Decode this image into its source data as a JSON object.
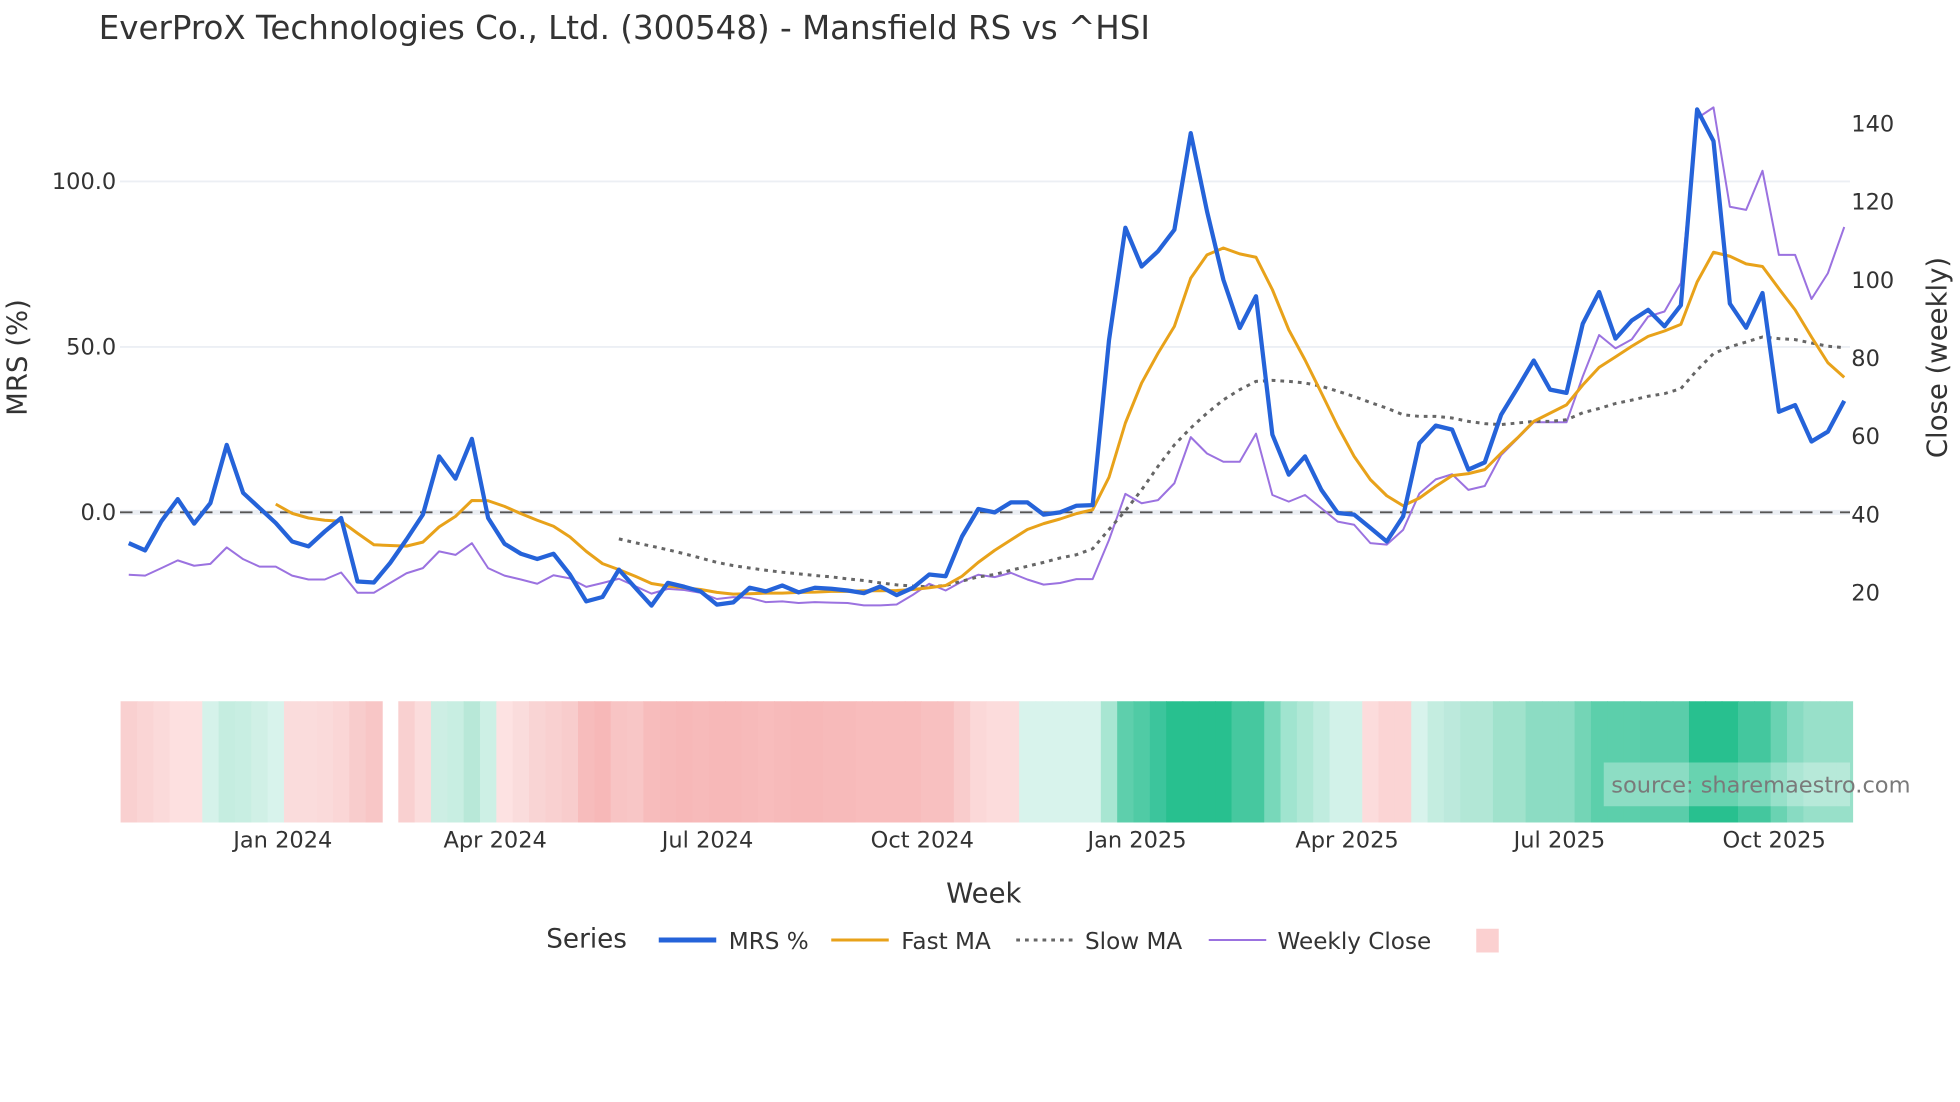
{
  "chart_data": {
    "type": "line",
    "title": "EverProX Technologies Co., Ltd. (300548) - Mansfield RS vs ^HSI",
    "xlabel": "Week",
    "ylabel": "MRS (%)",
    "y2label": "Close (weekly)",
    "x_start": "2023-10-27",
    "x_step_days": 7,
    "ylim": [
      -45,
      125
    ],
    "y2lim": [
      2.6,
      146.4
    ],
    "yticks": [
      {
        "value": 0,
        "label": "0.0"
      },
      {
        "value": 50,
        "label": "50.0"
      },
      {
        "value": 100,
        "label": "100.0"
      }
    ],
    "y2ticks": [
      {
        "value": 20,
        "label": "20"
      },
      {
        "value": 40,
        "label": "40"
      },
      {
        "value": 60,
        "label": "60"
      },
      {
        "value": 80,
        "label": "80"
      },
      {
        "value": 100,
        "label": "100"
      },
      {
        "value": 120,
        "label": "120"
      },
      {
        "value": 140,
        "label": "140"
      }
    ],
    "xticks": [
      {
        "date": "2024-01-01",
        "label": "Jan 2024"
      },
      {
        "date": "2024-04-01",
        "label": "Apr 2024"
      },
      {
        "date": "2024-07-01",
        "label": "Jul 2024"
      },
      {
        "date": "2024-10-01",
        "label": "Oct 2024"
      },
      {
        "date": "2025-01-01",
        "label": "Jan 2025"
      },
      {
        "date": "2025-04-01",
        "label": "Apr 2025"
      },
      {
        "date": "2025-07-01",
        "label": "Jul 2025"
      },
      {
        "date": "2025-10-01",
        "label": "Oct 2025"
      }
    ],
    "reference_line": 0,
    "grid": true,
    "legend": {
      "title": "Series",
      "placement": "bottom"
    },
    "series": [
      {
        "name": "MRS %",
        "axis": "y",
        "color": "#2563d9",
        "style": "solid",
        "values": [
          -9.3,
          -11.5,
          -2.7,
          4.0,
          -3.4,
          2.8,
          20.4,
          5.9,
          1.3,
          -3.2,
          -8.8,
          -10.3,
          -5.8,
          -1.7,
          -20.9,
          -21.2,
          -15.3,
          -8.2,
          -0.7,
          16.9,
          10.2,
          22.2,
          -1.7,
          -9.5,
          -12.5,
          -14.1,
          -12.5,
          -18.8,
          -26.9,
          -25.6,
          -17.3,
          -22.8,
          -28.2,
          -21.3,
          -22.5,
          -23.9,
          -27.9,
          -27.2,
          -22.8,
          -23.9,
          -22.1,
          -24.2,
          -22.8,
          -23.1,
          -23.6,
          -24.4,
          -22.4,
          -25.0,
          -22.8,
          -18.8,
          -19.3,
          -7.3,
          1.0,
          0.0,
          3.0,
          3.0,
          -0.7,
          0.0,
          2.0,
          2.2,
          52.0,
          86.0,
          74.3,
          78.9,
          85.4,
          114.6,
          91.0,
          70.3,
          55.7,
          65.3,
          23.5,
          11.4,
          16.9,
          6.8,
          -0.2,
          -0.7,
          -4.7,
          -8.8,
          -1.2,
          20.9,
          26.2,
          25.0,
          12.9,
          15.1,
          29.5,
          37.6,
          45.9,
          37.1,
          36.1,
          57.0,
          66.6,
          52.5,
          58.0,
          61.2,
          56.2,
          62.6,
          121.8,
          112.2,
          63.1,
          55.8,
          66.3,
          30.4,
          32.4,
          21.4,
          24.4,
          33.7
        ]
      },
      {
        "name": "Fast MA",
        "axis": "y",
        "color": "#e8a21a",
        "style": "solid",
        "values": [
          null,
          null,
          null,
          null,
          null,
          null,
          null,
          null,
          null,
          2.5,
          -0.3,
          -1.7,
          -2.4,
          -2.7,
          -6.3,
          -9.8,
          -10.0,
          -10.2,
          -9.0,
          -4.4,
          -1.2,
          3.6,
          3.5,
          1.8,
          -0.4,
          -2.4,
          -4.2,
          -7.4,
          -11.8,
          -15.5,
          -17.3,
          -19.3,
          -21.5,
          -22.3,
          -22.8,
          -23.3,
          -24.2,
          -24.7,
          -24.6,
          -24.4,
          -24.4,
          -24.2,
          -24.1,
          -23.9,
          -23.9,
          -23.7,
          -23.7,
          -23.6,
          -23.3,
          -22.8,
          -22.1,
          -19.3,
          -15.1,
          -11.5,
          -8.3,
          -5.2,
          -3.4,
          -2.0,
          -0.4,
          0.8,
          10.6,
          27.0,
          39.1,
          48.1,
          56.2,
          70.8,
          77.8,
          79.9,
          78.1,
          77.1,
          67.3,
          55.2,
          46.1,
          36.1,
          26.0,
          16.9,
          9.9,
          5.0,
          2.0,
          4.3,
          7.9,
          11.1,
          11.7,
          12.9,
          17.9,
          22.5,
          27.5,
          30.0,
          32.5,
          38.5,
          43.8,
          47.0,
          50.2,
          53.2,
          54.8,
          56.8,
          69.6,
          78.6,
          77.4,
          75.1,
          74.3,
          67.6,
          61.2,
          53.0,
          45.2,
          40.8
        ]
      },
      {
        "name": "Slow MA",
        "axis": "y",
        "color": "#666666",
        "style": "dot",
        "values": [
          null,
          null,
          null,
          null,
          null,
          null,
          null,
          null,
          null,
          null,
          null,
          null,
          null,
          null,
          null,
          null,
          null,
          null,
          null,
          null,
          null,
          null,
          null,
          null,
          null,
          null,
          null,
          null,
          null,
          null,
          -8.0,
          -9.2,
          -10.2,
          -11.3,
          -12.5,
          -13.8,
          -15.1,
          -16.1,
          -16.8,
          -17.5,
          -18.1,
          -18.6,
          -19.1,
          -19.5,
          -20.1,
          -20.6,
          -21.3,
          -21.9,
          -22.3,
          -22.5,
          -22.1,
          -20.8,
          -19.5,
          -18.8,
          -17.5,
          -16.3,
          -15.1,
          -13.8,
          -12.8,
          -11.0,
          -5.2,
          0.5,
          6.8,
          13.9,
          20.4,
          25.5,
          30.0,
          34.0,
          37.1,
          39.6,
          39.9,
          39.6,
          39.1,
          38.1,
          36.6,
          35.0,
          33.2,
          31.5,
          29.5,
          29.0,
          29.0,
          28.5,
          27.5,
          26.8,
          26.5,
          27.0,
          27.5,
          27.5,
          28.0,
          30.1,
          31.4,
          32.9,
          33.9,
          35.1,
          35.9,
          37.4,
          43.0,
          48.0,
          50.0,
          51.5,
          53.0,
          52.5,
          52.2,
          51.2,
          50.2,
          49.8
        ]
      },
      {
        "name": "Weekly Close",
        "axis": "y2",
        "color": "#9b72e0",
        "style": "solid",
        "values": [
          24.7,
          24.5,
          26.4,
          28.4,
          27.0,
          27.5,
          31.7,
          28.7,
          26.8,
          26.8,
          24.5,
          23.5,
          23.5,
          25.3,
          20.1,
          20.1,
          22.6,
          25.1,
          26.4,
          30.7,
          29.8,
          32.8,
          26.4,
          24.5,
          23.5,
          22.4,
          24.6,
          23.8,
          21.6,
          22.6,
          23.7,
          21.8,
          19.9,
          21.1,
          20.8,
          20.1,
          18.5,
          19.0,
          18.8,
          17.7,
          17.9,
          17.5,
          17.7,
          17.6,
          17.5,
          16.9,
          16.9,
          17.1,
          19.6,
          22.4,
          20.7,
          23.0,
          24.7,
          24.1,
          25.2,
          23.5,
          22.2,
          22.6,
          23.6,
          23.6,
          33.6,
          45.4,
          43.0,
          43.8,
          48.1,
          59.9,
          55.7,
          53.6,
          53.6,
          60.8,
          45.1,
          43.4,
          45.1,
          41.7,
          38.3,
          37.5,
          32.8,
          32.4,
          36.2,
          45.5,
          49.1,
          50.4,
          46.4,
          47.4,
          55.3,
          59.5,
          63.7,
          63.7,
          63.7,
          75.4,
          86.0,
          82.6,
          84.9,
          90.7,
          92.0,
          99.3,
          141.4,
          144.2,
          118.8,
          118.0,
          128.0,
          106.5,
          106.5,
          95.2,
          101.8,
          113.6
        ]
      }
    ],
    "heatmap": {
      "legend_color": "#fbd0d0",
      "colors": [
        "#f9d0d0",
        "#fad5d5",
        "#fbdada",
        "#fde0e0",
        "#fde0e0",
        "#d5f2ea",
        "#c5ede0",
        "#c8eee2",
        "#d0f0e6",
        "#d8f3ec",
        "#fadcdc",
        "#fadcdc",
        "#fadada",
        "#fad6d6",
        "#f8cccc",
        "#f8c6c6",
        null,
        "#f9d0d0",
        "#fbdcdc",
        "#cdeee4",
        "#c8eee2",
        "#b8e8d8",
        "#cdf0e5",
        "#fde2e2",
        "#fadcdc",
        "#f9d4d4",
        "#f9d0d0",
        "#f8cccc",
        "#f7bcbc",
        "#f7b8b8",
        "#f8c4c4",
        "#f8c6c6",
        "#f7bcbc",
        "#f7baba",
        "#f7b8b8",
        "#f7baba",
        "#f7b8b8",
        "#f7b8b8",
        "#f7baba",
        "#f8bcbc",
        "#f7baba",
        "#f7b8b8",
        "#f7b8b8",
        "#f7baba",
        "#f7baba",
        "#f8bcbc",
        "#f8bcbc",
        "#f8bcbc",
        "#f8bcbc",
        "#f8c0c0",
        "#f8c0c0",
        "#f9cccc",
        "#fbd8d8",
        "#fcdcdc",
        "#fcdcdc",
        "#d8f3ec",
        "#d8f3ec",
        "#d8f3ec",
        "#d8f3ec",
        "#d8f3ec",
        "#a8e6d2",
        "#5ecfac",
        "#50cba5",
        "#3cc59c",
        "#28c08f",
        "#28c08f",
        "#28c08f",
        "#28c08f",
        "#46c89f",
        "#46c89f",
        "#78d8ba",
        "#a0e4cf",
        "#b0e8d6",
        "#c0ecdf",
        "#d2f2e9",
        "#d2f2e9",
        "#fcdcdc",
        "#fbd4d4",
        "#fbd4d4",
        "#d8f3ec",
        "#c4ede0",
        "#bce9dc",
        "#b2e7d6",
        "#b2e7d6",
        "#a0e2cc",
        "#a0e2cc",
        "#8cdcc3",
        "#8cdcc3",
        "#8cdcc3",
        "#74d5b6",
        "#5ccfab",
        "#5ccfab",
        "#5ccfab",
        "#5acdaa",
        "#5acdaa",
        "#5acdaa",
        "#28c08f",
        "#28c08f",
        "#28c08f",
        "#44c79e",
        "#44c79e",
        "#6ad3b2",
        "#88dbc2",
        "#98e0c9",
        "#98e0c9",
        "#98e0c9"
      ]
    },
    "watermark": "source: sharemaestro.com"
  }
}
